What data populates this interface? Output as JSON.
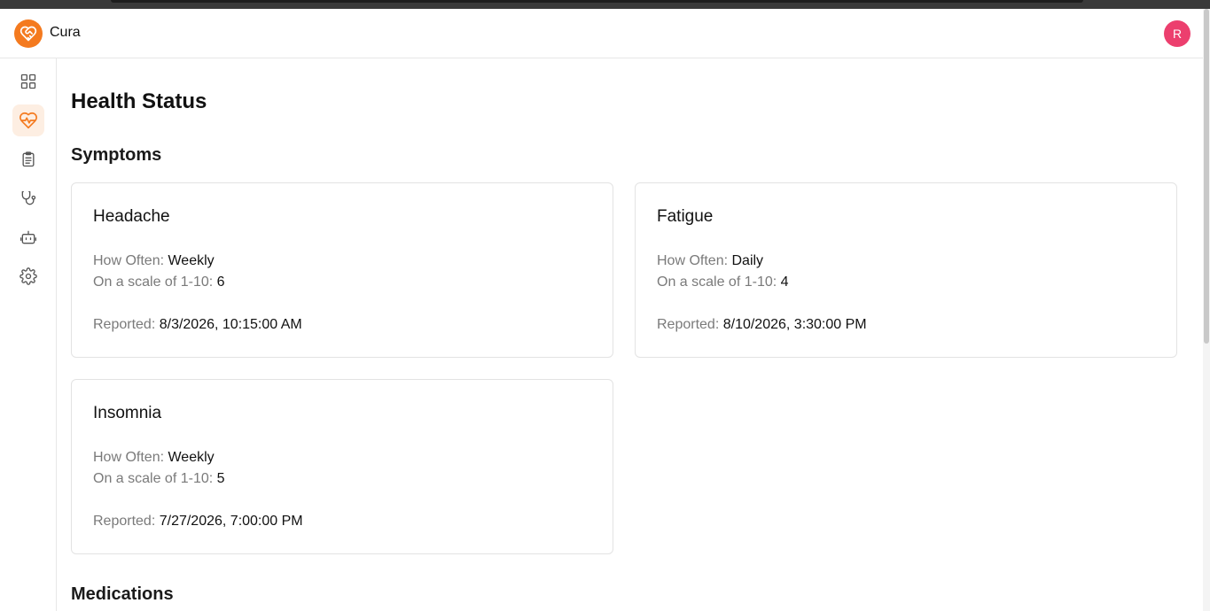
{
  "app": {
    "name": "Cura",
    "user_initial": "R"
  },
  "colors": {
    "accent": "#f47a1f",
    "avatar": "#ec3f6e",
    "active_nav_bg": "#fdeee2"
  },
  "sidebar": {
    "items": [
      {
        "icon": "dashboard-grid-icon",
        "active": false
      },
      {
        "icon": "heart-pulse-icon",
        "active": true
      },
      {
        "icon": "clipboard-icon",
        "active": false
      },
      {
        "icon": "stethoscope-icon",
        "active": false
      },
      {
        "icon": "robot-icon",
        "active": false
      },
      {
        "icon": "gear-icon",
        "active": false
      }
    ]
  },
  "page": {
    "title": "Health Status",
    "sections": {
      "symptoms": "Symptoms",
      "medications": "Medications"
    }
  },
  "symptoms": [
    {
      "name": "Headache",
      "how_often_label": "How Often:",
      "how_often": "Weekly",
      "scale_label": "On a scale of 1-10:",
      "scale": "6",
      "reported_label": "Reported:",
      "reported": "8/3/2026, 10:15:00 AM"
    },
    {
      "name": "Fatigue",
      "how_often_label": "How Often:",
      "how_often": "Daily",
      "scale_label": "On a scale of 1-10:",
      "scale": "4",
      "reported_label": "Reported:",
      "reported": "8/10/2026, 3:30:00 PM"
    },
    {
      "name": "Insomnia",
      "how_often_label": "How Often:",
      "how_often": "Weekly",
      "scale_label": "On a scale of 1-10:",
      "scale": "5",
      "reported_label": "Reported:",
      "reported": "7/27/2026, 7:00:00 PM"
    }
  ]
}
